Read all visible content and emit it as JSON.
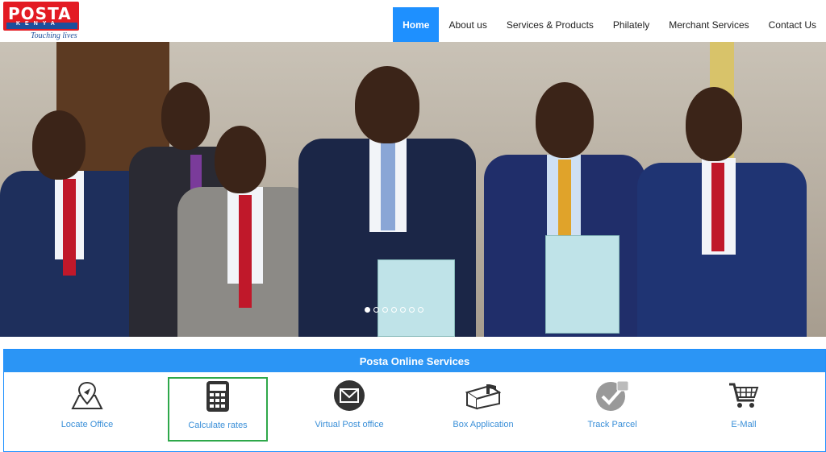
{
  "brand": {
    "logo_text": "POSTA",
    "logo_subtext": "KENYA",
    "tagline": "Touching lives"
  },
  "nav": {
    "items": [
      {
        "label": "Home",
        "active": true
      },
      {
        "label": "About us",
        "active": false
      },
      {
        "label": "Services & Products",
        "active": false
      },
      {
        "label": "Philately",
        "active": false
      },
      {
        "label": "Merchant Services",
        "active": false
      },
      {
        "label": "Contact Us",
        "active": false
      }
    ]
  },
  "carousel": {
    "slide_count": 7,
    "active_slide": 1
  },
  "services": {
    "title": "Posta Online Services",
    "items": [
      {
        "label": "Locate Office",
        "icon": "map-pin-icon"
      },
      {
        "label": "Calculate rates",
        "icon": "calculator-icon",
        "selected": true
      },
      {
        "label": "Virtual Post office",
        "icon": "envelope-icon"
      },
      {
        "label": "Box Application",
        "icon": "mailbox-icon"
      },
      {
        "label": "Track Parcel",
        "icon": "check-badge-icon"
      },
      {
        "label": "E-Mall",
        "icon": "shopping-cart-icon"
      }
    ]
  },
  "colors": {
    "brand_red": "#e31b23",
    "brand_blue": "#1d4f9c",
    "accent_blue": "#1e90ff",
    "selected_border": "#2ea84a"
  }
}
